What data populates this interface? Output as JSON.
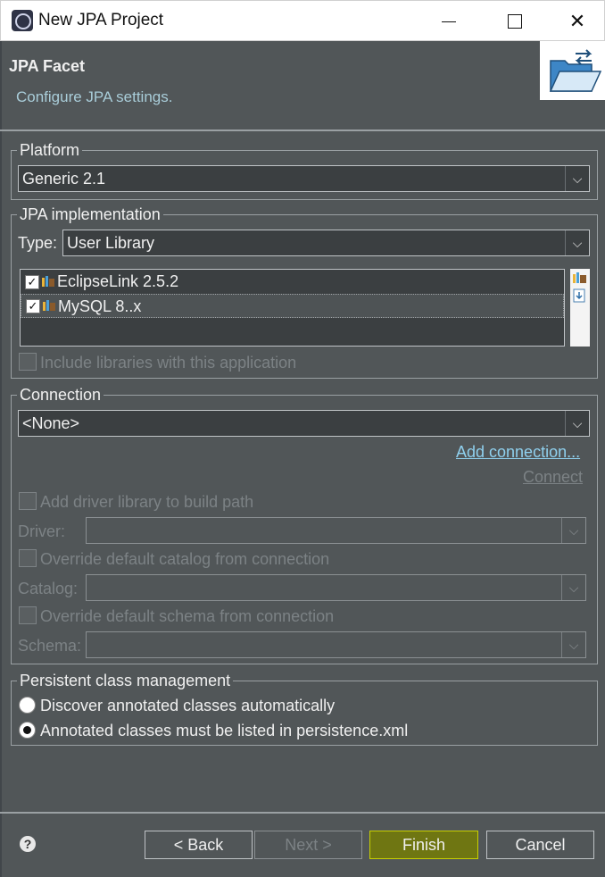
{
  "window": {
    "title": "New JPA Project",
    "minimize_glyph": "—",
    "maximize_glyph": "☐",
    "close_glyph": "✕"
  },
  "header": {
    "title": "JPA Facet",
    "subtitle": "Configure JPA settings.",
    "banner_icon": "folder-open-icon"
  },
  "platform": {
    "legend": "Platform",
    "selected": "Generic 2.1"
  },
  "jpa_implementation": {
    "legend": "JPA implementation",
    "type_label": "Type:",
    "type_value": "User Library",
    "libraries": [
      {
        "name": "EclipseLink 2.5.2",
        "checked": true,
        "check": "✓"
      },
      {
        "name": "MySQL 8..x",
        "checked": true,
        "check": "✓"
      }
    ],
    "include_libraries_label": "Include libraries with this application"
  },
  "connection": {
    "legend": "Connection",
    "selected": "<None>",
    "add_connection": "Add connection...",
    "connect": "Connect",
    "add_driver_label": "Add driver library to build path",
    "driver_label": "Driver:",
    "override_catalog_label": "Override default catalog from connection",
    "catalog_label": "Catalog:",
    "override_schema_label": "Override default schema from connection",
    "schema_label": "Schema:"
  },
  "persistent": {
    "legend": "Persistent class management",
    "options": [
      {
        "label": "Discover annotated classes automatically",
        "selected": false
      },
      {
        "label": "Annotated classes must be listed in persistence.xml",
        "selected": true
      }
    ]
  },
  "footer": {
    "help": "?",
    "back": "< Back",
    "next": "Next >",
    "finish": "Finish",
    "cancel": "Cancel"
  },
  "colors": {
    "background": "#515658",
    "link": "#8fd0ee",
    "finish_highlight": "#c8d000"
  },
  "combo_arrow_glyph": "⌵"
}
